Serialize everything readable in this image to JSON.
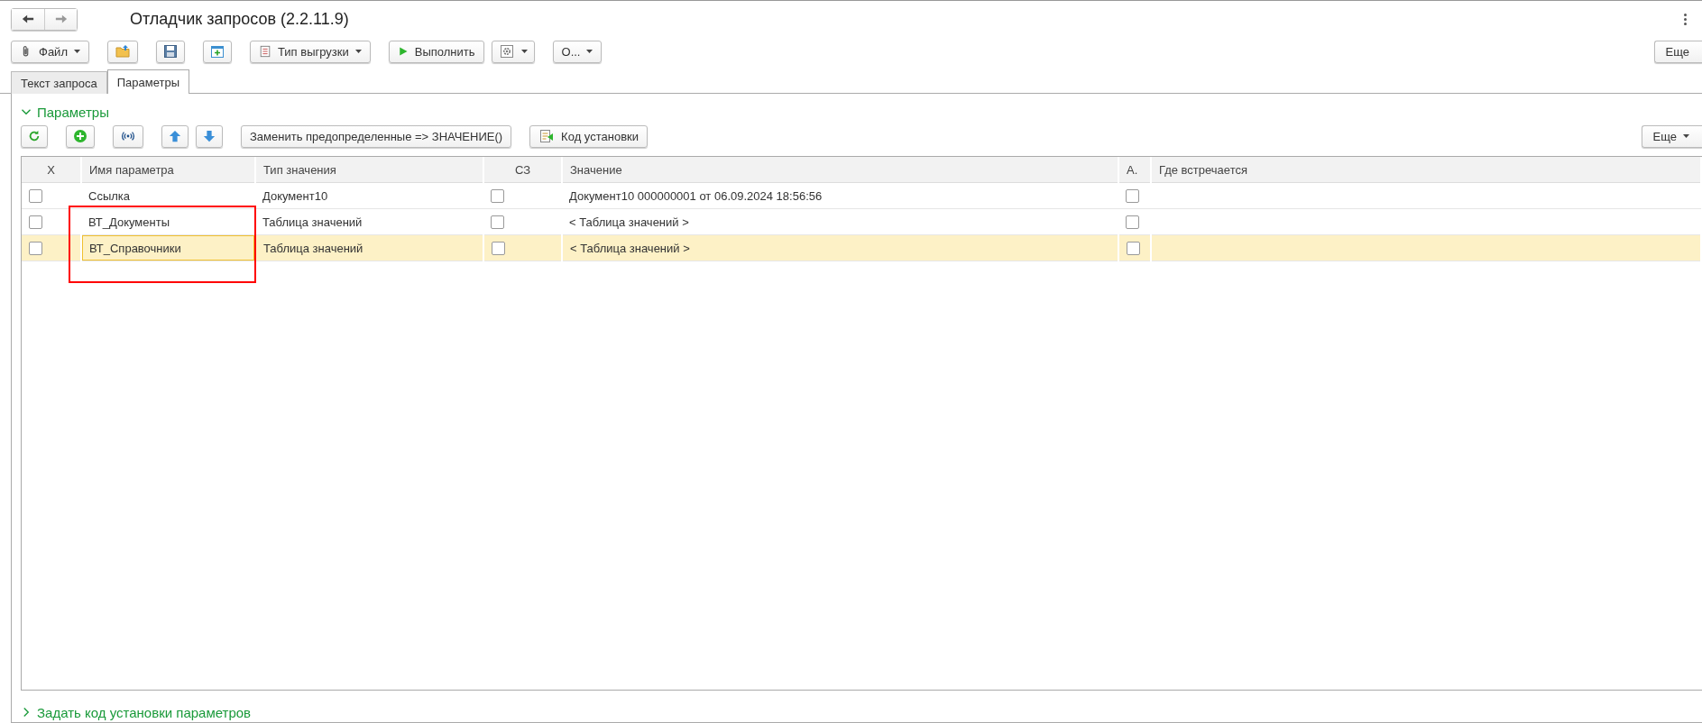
{
  "window": {
    "title": "Отладчик запросов (2.2.11.9)"
  },
  "toolbar": {
    "buttons": [
      {
        "kind": "text",
        "label": "Файл",
        "dropdown": true
      },
      {
        "kind": "icon",
        "dropdown": false
      },
      {
        "kind": "icon",
        "dropdown": false
      },
      {
        "kind": "icon",
        "dropdown": false
      },
      {
        "kind": "text",
        "label": "Тип выгрузки",
        "dropdown": true
      },
      {
        "kind": "text",
        "label": "Выполнить",
        "dropdown": false
      },
      {
        "kind": "icon",
        "dropdown": true
      },
      {
        "kind": "text",
        "label": "О...",
        "dropdown": true
      }
    ],
    "more": "Еще"
  },
  "tabs": [
    {
      "label": "Текст запроса",
      "selected": false
    },
    {
      "label": "Параметры",
      "selected": true
    }
  ],
  "parameters_group": {
    "title": "Параметры",
    "expanded": true,
    "toolbar": {
      "buttons": [
        {
          "kind": "icon"
        },
        {
          "kind": "icon"
        },
        {
          "kind": "icon"
        },
        {
          "kind": "icon"
        },
        {
          "kind": "icon"
        },
        {
          "kind": "text",
          "label": "Заменить предопределенные => ЗНАЧЕНИЕ()"
        },
        {
          "kind": "text",
          "label": "Код установки"
        }
      ],
      "more": "Еще"
    },
    "table": {
      "columns": [
        "X",
        "Имя параметра",
        "Тип значения",
        "СЗ",
        "Значение",
        "А.",
        "Где встречается"
      ],
      "rows": [
        {
          "checked": false,
          "name": "Ссылка",
          "type": "Документ10",
          "sz": false,
          "value": "Документ10 000000001 от 06.09.2024 18:56:56",
          "a": false,
          "selected": false
        },
        {
          "checked": false,
          "name": "ВТ_Документы",
          "type": "Таблица значений",
          "sz": false,
          "value": "< Таблица значений >",
          "a": false,
          "selected": false
        },
        {
          "checked": false,
          "name": "ВТ_Справочники",
          "type": "Таблица значений",
          "sz": false,
          "value": "< Таблица значений >",
          "a": false,
          "selected": true
        }
      ]
    }
  },
  "code_group": {
    "title": "Задать код установки параметров",
    "expanded": false
  }
}
